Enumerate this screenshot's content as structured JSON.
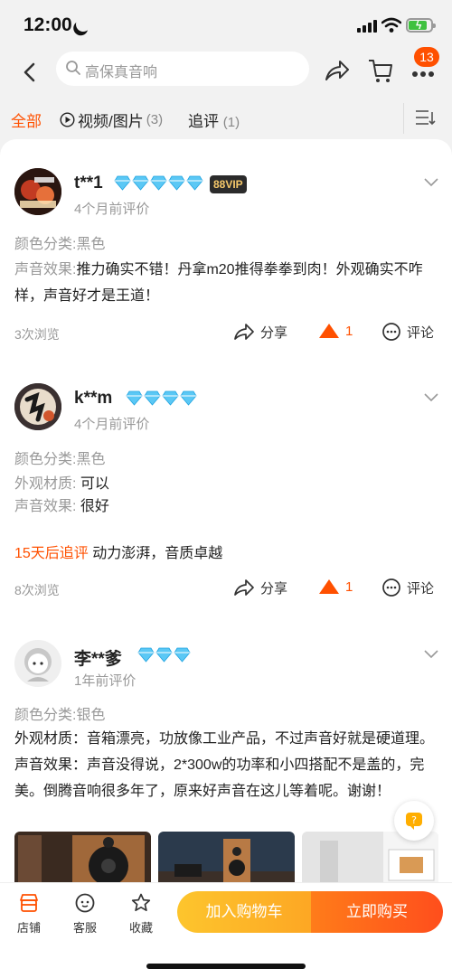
{
  "status": {
    "time": "12:00"
  },
  "search": {
    "placeholder": "高保真音响"
  },
  "cart_badge": "13",
  "tabs": [
    {
      "label": "全部",
      "count": ""
    },
    {
      "label": "视频/图片",
      "count": "(3)"
    },
    {
      "label": "追评",
      "count": "(1)"
    }
  ],
  "reviews": [
    {
      "username": "t**1",
      "diamonds": 5,
      "vip": "88VIP",
      "time": "4个月前评价",
      "variant": "颜色分类:黑色",
      "lines": [
        {
          "label": "声音效果:",
          "text": "推力确实不错！丹拿m20推得拳拳到肉！外观确实不咋样，声音好才是王道！"
        }
      ],
      "views": "3次浏览",
      "share": "分享",
      "likes": "1",
      "comment": "评论"
    },
    {
      "username": "k**m",
      "diamonds": 4,
      "time": "4个月前评价",
      "variant": "颜色分类:黑色",
      "lines": [
        {
          "label": "外观材质:",
          "text": "可以"
        },
        {
          "label": "声音效果:",
          "text": "很好"
        }
      ],
      "followup_label": "15天后追评",
      "followup_text": "动力澎湃，音质卓越",
      "views": "8次浏览",
      "share": "分享",
      "likes": "1",
      "comment": "评论"
    },
    {
      "username": "李**爹",
      "diamonds": 3,
      "time": "1年前评价",
      "variant": "颜色分类:银色",
      "body": "外观材质：音箱漂亮，功放像工业产品，不过声音好就是硬道理。声音效果：声音没得说，2*300w的功率和小四搭配不是盖的，完美。倒腾音响很多年了，原来好声音在这儿等着呢。谢谢！"
    }
  ],
  "bottom": {
    "store": "店铺",
    "service": "客服",
    "favorite": "收藏",
    "add_cart": "加入购物车",
    "buy_now": "立即购买"
  },
  "colors": {
    "accent": "#ff5000",
    "diamond": "#5bc8f5"
  }
}
